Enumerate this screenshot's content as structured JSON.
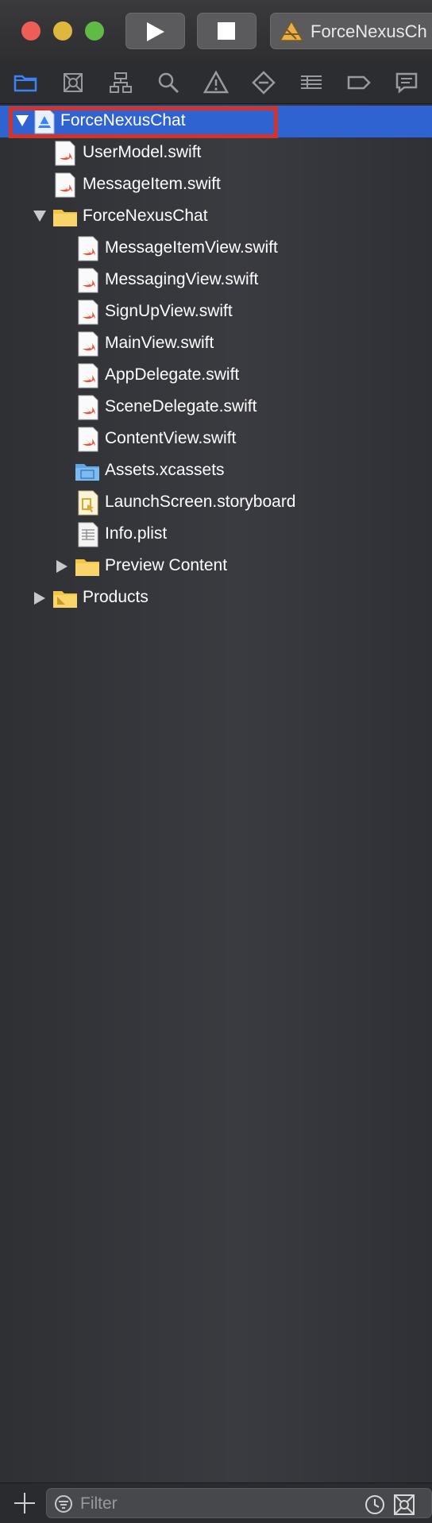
{
  "toolbar": {
    "scheme_label": "ForceNexusCh",
    "run_icon": "play-icon",
    "stop_icon": "stop-icon"
  },
  "navigator_tabs": [
    {
      "name": "project-navigator",
      "icon": "folder-icon",
      "active": true
    },
    {
      "name": "source-control-navigator",
      "icon": "source-control-icon",
      "active": false
    },
    {
      "name": "symbol-navigator",
      "icon": "hierarchy-icon",
      "active": false
    },
    {
      "name": "find-navigator",
      "icon": "search-icon",
      "active": false
    },
    {
      "name": "issue-navigator",
      "icon": "warning-icon",
      "active": false
    },
    {
      "name": "test-navigator",
      "icon": "diamond-icon",
      "active": false
    },
    {
      "name": "debug-navigator",
      "icon": "list-icon",
      "active": false
    },
    {
      "name": "breakpoint-navigator",
      "icon": "tag-icon",
      "active": false
    },
    {
      "name": "report-navigator",
      "icon": "speech-bubble-icon",
      "active": false
    }
  ],
  "tree": [
    {
      "label": "ForceNexusChat",
      "type": "project",
      "indent": 0,
      "disclosure": "open",
      "selected": true
    },
    {
      "label": "UserModel.swift",
      "type": "swift",
      "indent": 1,
      "disclosure": "none"
    },
    {
      "label": "MessageItem.swift",
      "type": "swift",
      "indent": 1,
      "disclosure": "none"
    },
    {
      "label": "ForceNexusChat",
      "type": "folder",
      "indent": 1,
      "disclosure": "open"
    },
    {
      "label": "MessageItemView.swift",
      "type": "swift",
      "indent": 2,
      "disclosure": "none"
    },
    {
      "label": "MessagingView.swift",
      "type": "swift",
      "indent": 2,
      "disclosure": "none"
    },
    {
      "label": "SignUpView.swift",
      "type": "swift",
      "indent": 2,
      "disclosure": "none"
    },
    {
      "label": "MainView.swift",
      "type": "swift",
      "indent": 2,
      "disclosure": "none"
    },
    {
      "label": "AppDelegate.swift",
      "type": "swift",
      "indent": 2,
      "disclosure": "none"
    },
    {
      "label": "SceneDelegate.swift",
      "type": "swift",
      "indent": 2,
      "disclosure": "none"
    },
    {
      "label": "ContentView.swift",
      "type": "swift",
      "indent": 2,
      "disclosure": "none"
    },
    {
      "label": "Assets.xcassets",
      "type": "assets",
      "indent": 2,
      "disclosure": "none"
    },
    {
      "label": "LaunchScreen.storyboard",
      "type": "storyboard",
      "indent": 2,
      "disclosure": "none"
    },
    {
      "label": "Info.plist",
      "type": "plist",
      "indent": 2,
      "disclosure": "none"
    },
    {
      "label": "Preview Content",
      "type": "folder",
      "indent": 2,
      "disclosure": "closed"
    },
    {
      "label": "Products",
      "type": "folder",
      "indent": 1,
      "disclosure": "closed"
    }
  ],
  "filter": {
    "placeholder": "Filter",
    "value": ""
  },
  "colors": {
    "selection": "#2f63d1",
    "highlight_box": "#d4332a",
    "folder": "#f5c445",
    "swift": "#f05138"
  }
}
